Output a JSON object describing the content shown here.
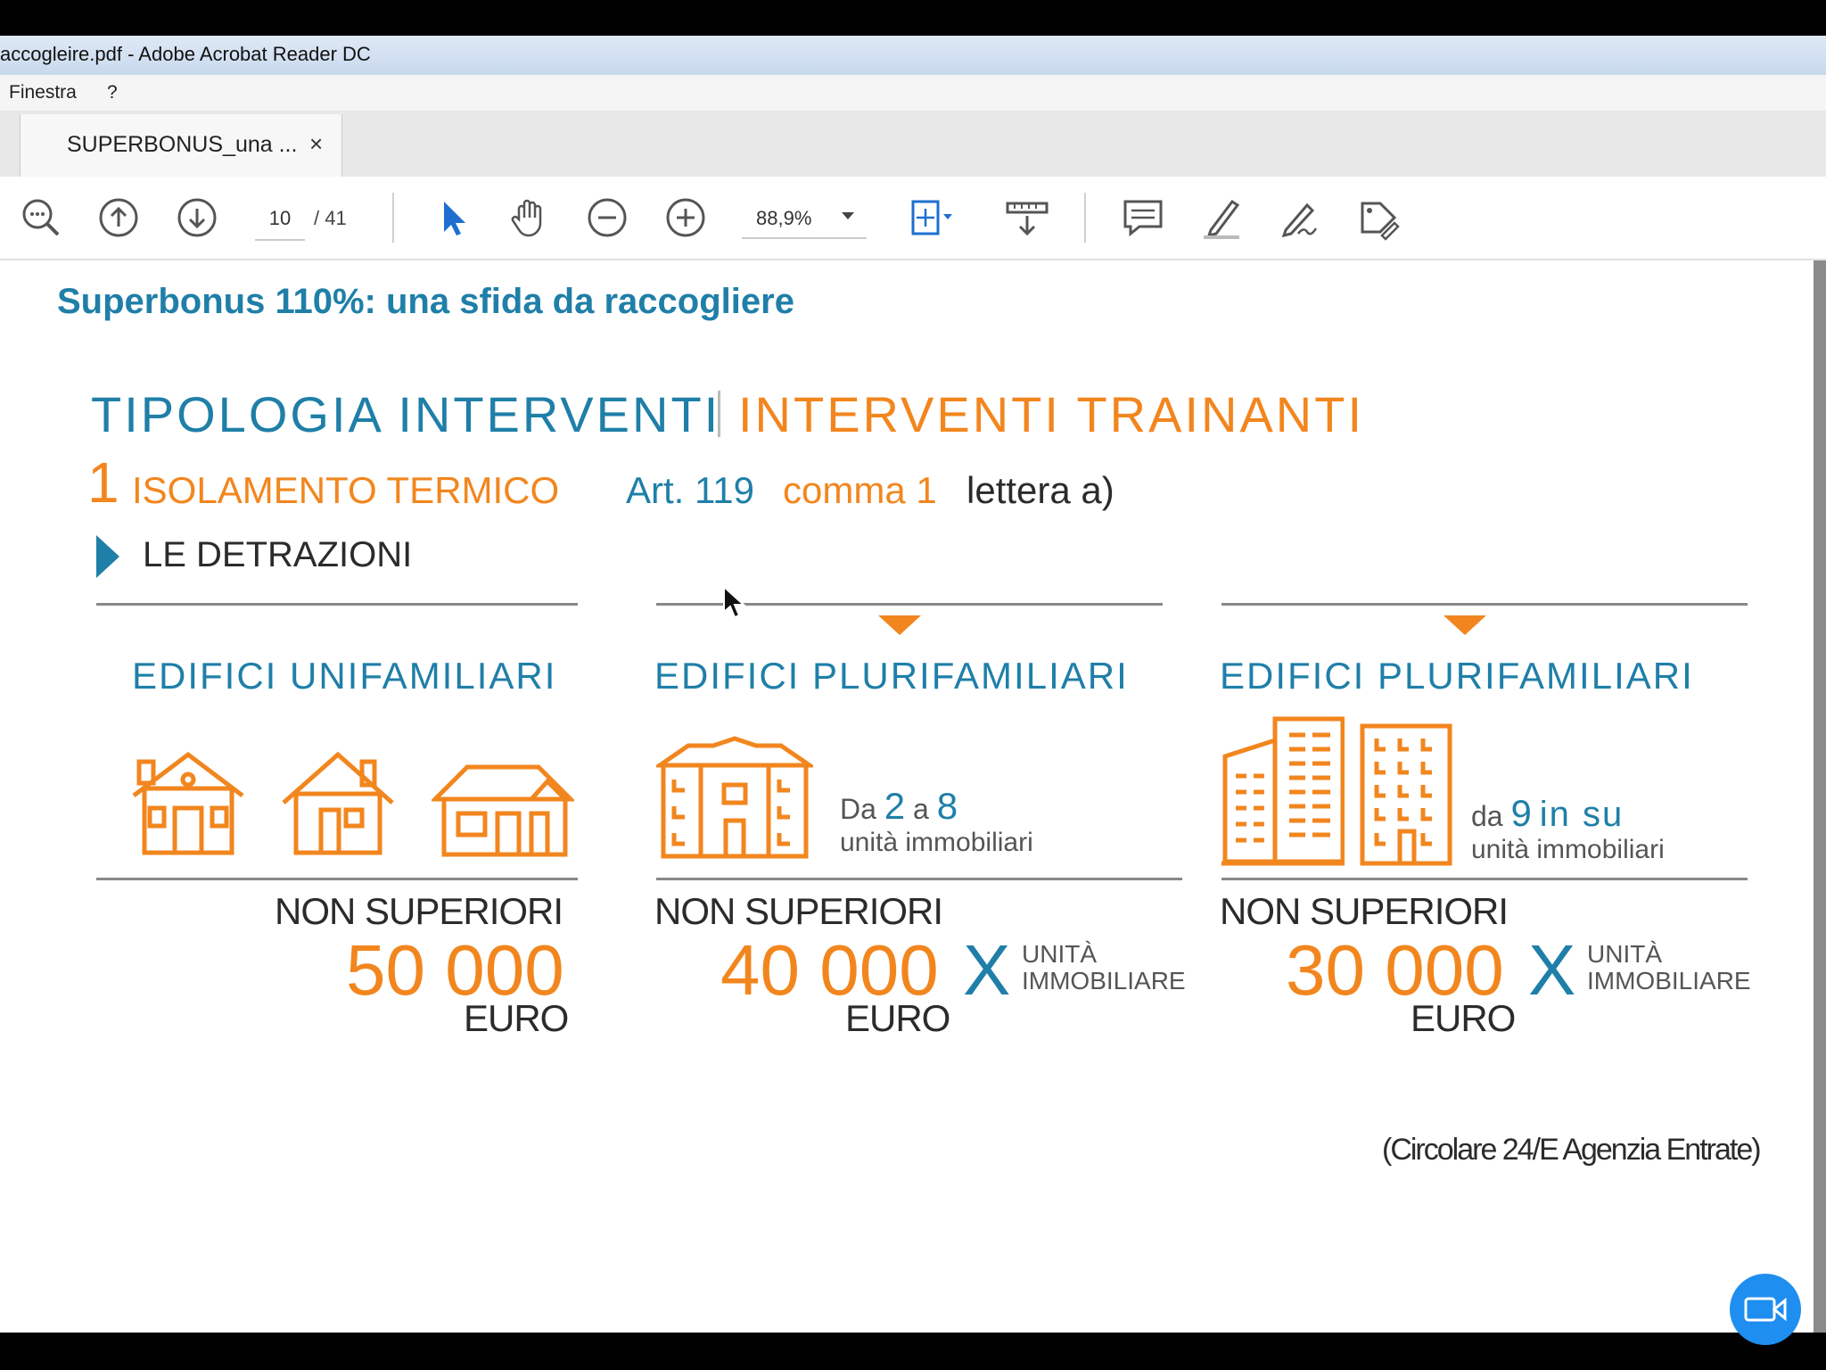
{
  "window": {
    "title": "accogleire.pdf - Adobe Acrobat Reader DC"
  },
  "menu": {
    "items": [
      "Finestra",
      "?"
    ]
  },
  "tab": {
    "label": "SUPERBONUS_una ...",
    "close": "×"
  },
  "toolbar": {
    "page_current": "10",
    "page_total": "/ 41",
    "zoom": "88,9%"
  },
  "icons": [
    "zoom-out-icon",
    "arrow-up-icon",
    "arrow-down-icon",
    "select-pointer-icon",
    "hand-icon",
    "minus-circle-icon",
    "plus-circle-icon",
    "fit-page-icon",
    "scroll-mode-icon",
    "comment-icon",
    "highlight-icon",
    "sign-icon",
    "tag-icon",
    "video-camera-icon"
  ],
  "document": {
    "header": "Superbonus 110%: una sfida da raccogliere",
    "tipologia": "TIPOLOGIA INTERVENTI",
    "trainanti": "INTERVENTI TRAINANTI",
    "number": "1",
    "isolamento": "ISOLAMENTO TERMICO",
    "art": "Art. 119",
    "comma": "comma 1",
    "lettera": "lettera a)",
    "detrazioni": "LE DETRAZIONI",
    "columns": [
      {
        "title": "EDIFICI UNIFAMILIARI",
        "non_sup": "NON SUPERIORI",
        "amount": "50 000",
        "euro": "EURO"
      },
      {
        "title": "EDIFICI PLURIFAMILIARI",
        "desc_pre": "Da",
        "desc_a": "2",
        "desc_mid": "a",
        "desc_b": "8",
        "desc_sub": "unità immobiliari",
        "non_sup": "NON SUPERIORI",
        "amount": "40 000",
        "x": "X",
        "unit1": "UNITÀ",
        "unit2": "IMMOBILIARE",
        "euro": "EURO"
      },
      {
        "title": "EDIFICI PLURIFAMILIARI",
        "desc_pre": "da",
        "desc_a": "9",
        "desc_b": "in su",
        "desc_sub": "unità immobiliari",
        "non_sup": "NON SUPERIORI",
        "amount": "30 000",
        "x": "X",
        "unit1": "UNITÀ",
        "unit2": "IMMOBILIARE",
        "euro": "EURO"
      }
    ],
    "source": "(Circolare 24/E Agenzia Entrate)"
  },
  "colors": {
    "blue": "#1f7fa8",
    "orange": "#f2861e"
  }
}
